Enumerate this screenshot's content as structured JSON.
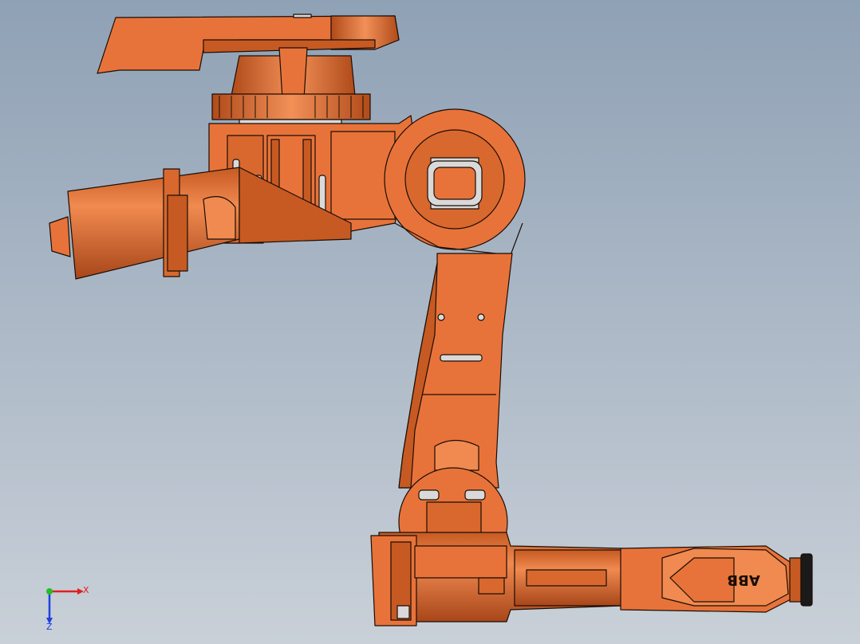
{
  "viewport": {
    "background_top": "#8fa1b5",
    "background_bottom": "#c9d0d8"
  },
  "robot": {
    "part_color": "#e8733a",
    "part_shade": "#b54c18",
    "part_highlight": "#f4915a",
    "edge_color": "#1a0d05",
    "insert_color": "#d9d9d9",
    "brand_text": "ABB"
  },
  "triad": {
    "x_label": "X",
    "z_label": "Z",
    "x_color": "#e02020",
    "y_color": "#20c020",
    "z_color": "#2040e0"
  }
}
